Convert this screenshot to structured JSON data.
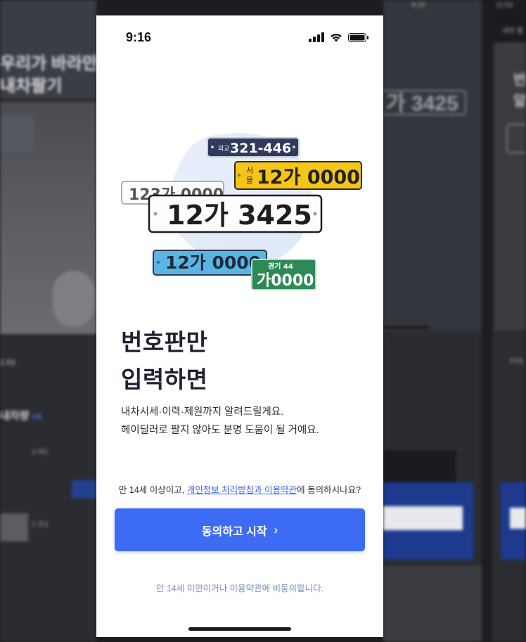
{
  "background": {
    "left": {
      "headline_1": "우리가 바라만",
      "headline_2": "내차팔기",
      "time": "1:53",
      "list_title": "내차량",
      "list_count": "2대",
      "item_1": "3 버2",
      "item_2": "2 조3"
    },
    "right_1": {
      "time": "9:16",
      "plate_text": "가 3425"
    },
    "right_2": {
      "time": "11:53",
      "tab": "내차 팔",
      "title_1": "번",
      "title_2": "알",
      "time_2": "5:51"
    }
  },
  "status_bar": {
    "time": "9:16"
  },
  "plates": {
    "navy": {
      "region": "외교",
      "number": "321-446"
    },
    "yellow": {
      "region_1": "서",
      "region_2": "울",
      "number": "12가 0000"
    },
    "old_white": {
      "number": "123가 0000"
    },
    "main": {
      "number": "12가 3425"
    },
    "blue": {
      "number": "12가 0000"
    },
    "green": {
      "top": "경기 44",
      "number": "가0000"
    }
  },
  "headline": {
    "line1": "번호판만",
    "line2": "입력하면"
  },
  "description": {
    "line1": "내차시세·이력·제원까지 알려드릴게요.",
    "line2": "헤이딜러로 팔지 않아도 분명 도움이 될 거예요."
  },
  "consent": {
    "prefix": "만 14세 이상이고, ",
    "link": "개인정보 처리방침과 이용약관",
    "suffix": "에 동의하시나요?"
  },
  "cta": {
    "label": "동의하고 시작",
    "chevron": "›"
  },
  "decline_link": "만 14세 미만이거나 이용약관에 비동의합니다.",
  "colors": {
    "primary": "#3d6cf4",
    "link": "#3a63f0",
    "plate_navy": "#2f3a5c",
    "plate_yellow": "#f5c518",
    "plate_blue": "#5bb5e3",
    "plate_green": "#2e8a55"
  }
}
